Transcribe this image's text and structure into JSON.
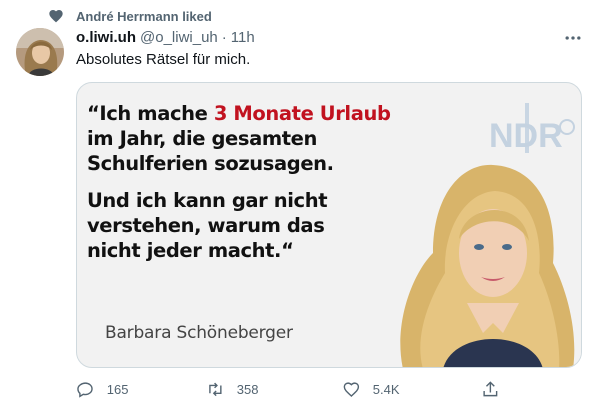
{
  "social_context": {
    "text": "André Herrmann liked"
  },
  "tweet": {
    "display_name": "o.liwi.uh",
    "handle": "@o_liwi_uh",
    "separator": "·",
    "time": "11h",
    "text": "Absolutes Rätsel für mich."
  },
  "media": {
    "quote_open": "“",
    "quote_line1_pre": "Ich mache ",
    "quote_highlight": "3 Monate Urlaub",
    "quote_line2": "im Jahr, die gesamten",
    "quote_line3": "Schulferien sozusagen.",
    "quote_line4": "Und ich kann gar nicht",
    "quote_line5": "verstehen, warum das",
    "quote_line6": "nicht jeder macht.“",
    "author": "Barbara Schöneberger",
    "logo_text": "NDR",
    "highlight_color": "#c1121f"
  },
  "actions": {
    "replies": "165",
    "retweets": "358",
    "likes": "5.4K"
  },
  "icons": {
    "heart": "heart-icon",
    "more": "more-icon",
    "reply": "reply-icon",
    "retweet": "retweet-icon",
    "like": "like-icon",
    "share": "share-icon"
  }
}
